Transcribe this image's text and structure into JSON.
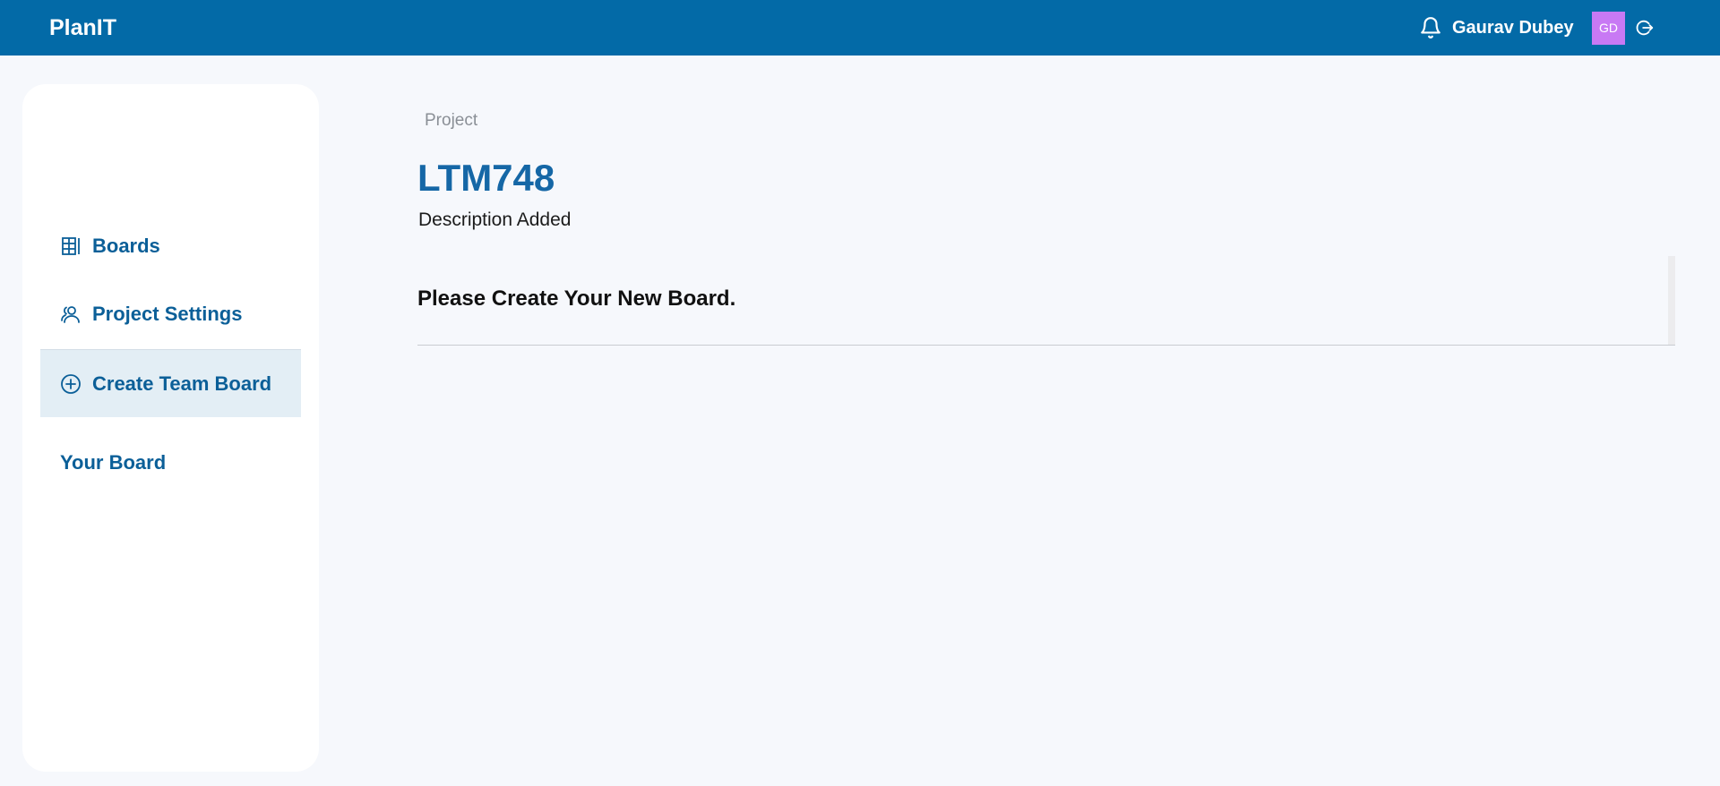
{
  "header": {
    "brand": "PlanIT",
    "user_name": "Gaurav Dubey",
    "avatar_initials": "GD",
    "bar_color": "#036aa7",
    "avatar_color": "#c879f4",
    "icons": [
      "bell-icon",
      "logout-icon"
    ]
  },
  "sidebar": {
    "items": [
      {
        "label": "Boards",
        "icon": "board-grid-icon",
        "active": false
      },
      {
        "label": "Project Settings",
        "icon": "users-icon",
        "active": false
      },
      {
        "label": "Create Team Board",
        "icon": "plus-circle-icon",
        "active": true
      },
      {
        "label": "Your Board",
        "icon": "",
        "active": false
      }
    ]
  },
  "main": {
    "breadcrumb": "Project",
    "title": "LTM748",
    "description": "Description Added",
    "empty_message": "Please Create Your New Board."
  }
}
